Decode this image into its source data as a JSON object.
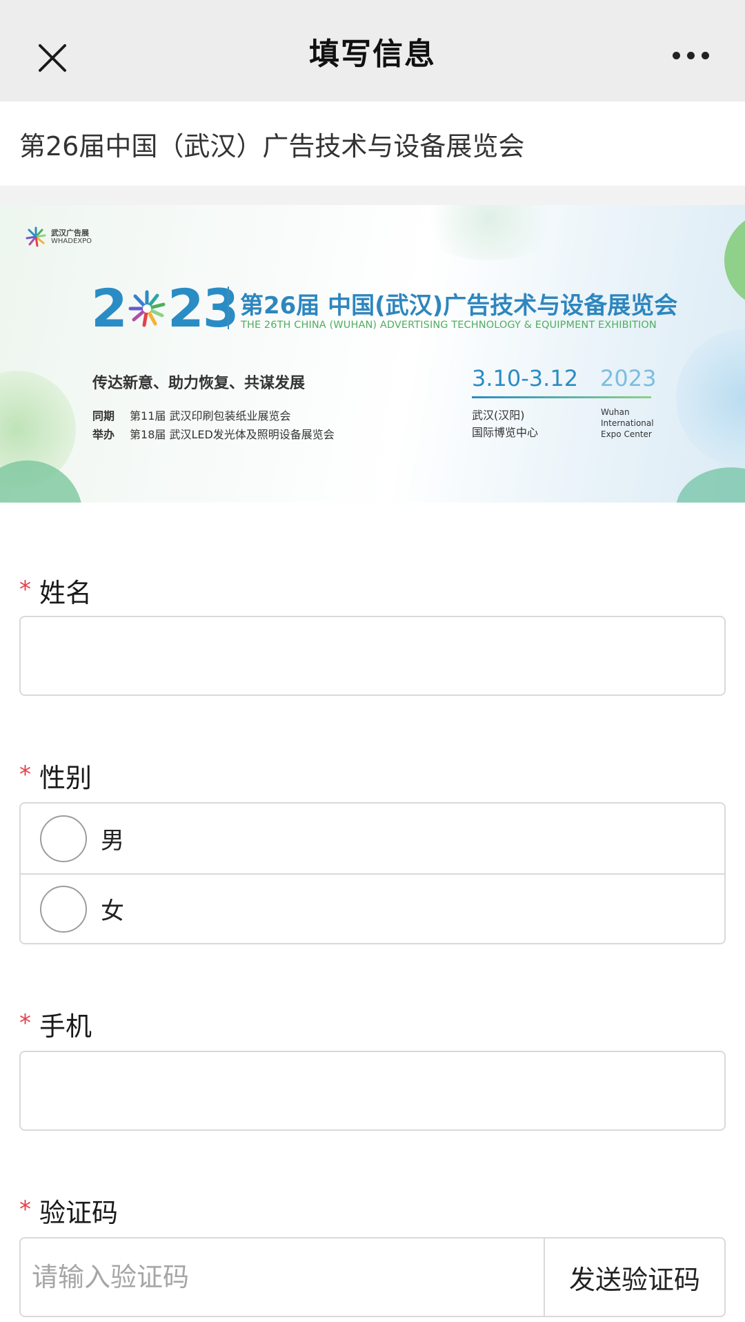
{
  "header": {
    "title": "填写信息",
    "close_icon": "close-icon",
    "more_icon": "more-dots-icon"
  },
  "event": {
    "title": "第26届中国（武汉）广告技术与设备展览会"
  },
  "banner": {
    "logo_cn": "武汉广告展",
    "logo_en": "WHADEXPO",
    "year_prefix": "2",
    "year_suffix": "23",
    "title_cn": "第26届 中国(武汉)广告技术与设备展览会",
    "title_en": "THE 26TH CHINA (WUHAN) ADVERTISING TECHNOLOGY & EQUIPMENT EXHIBITION",
    "slogan": "传达新意、助力恢复、共谋发展",
    "concurrent_key": "同期",
    "concurrent_value": "第11届 武汉印刷包装纸业展览会",
    "host_key": "举办",
    "host_value": "第18届 武汉LED发光体及照明设备展览会",
    "dates": "3.10-3.12",
    "dates_year": "2023",
    "venue_line1": "武汉(汉阳)",
    "venue_line2": "国际博览中心",
    "venue_en_line1": "Wuhan",
    "venue_en_line2": "International",
    "venue_en_line3": "Expo Center",
    "colors": {
      "blue": "#2a8cc4",
      "green": "#4fae5e"
    }
  },
  "form": {
    "required_mark": "*",
    "name_label": "姓名",
    "name_value": "",
    "gender_label": "性别",
    "gender_options": [
      "男",
      "女"
    ],
    "phone_label": "手机",
    "phone_value": "",
    "code_label": "验证码",
    "code_placeholder": "请输入验证码",
    "send_code_button": "发送验证码",
    "required_color": "#e2424b"
  }
}
